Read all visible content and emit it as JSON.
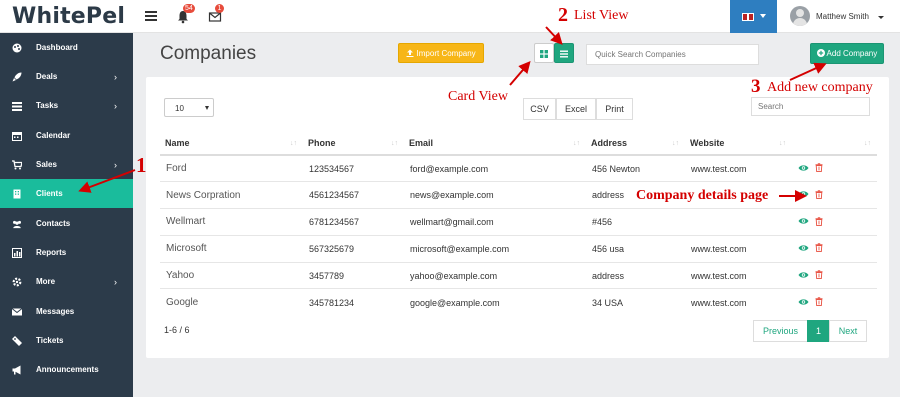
{
  "brand": {
    "logo": "WhitePel"
  },
  "topbar": {
    "notifications_count": "54",
    "messages_count": "1",
    "user_name": "Matthew Smith",
    "colors": {
      "lang_bg": "#2e7ec0",
      "badge": "#e74c3c"
    }
  },
  "sidebar": {
    "items": [
      {
        "label": "Dashboard",
        "icon": "palette-icon",
        "chevron": ""
      },
      {
        "label": "Deals",
        "icon": "rocket-icon",
        "chevron": "›"
      },
      {
        "label": "Tasks",
        "icon": "tasks-icon",
        "chevron": "›"
      },
      {
        "label": "Calendar",
        "icon": "calendar-icon",
        "chevron": ""
      },
      {
        "label": "Sales",
        "icon": "cart-icon",
        "chevron": "›"
      },
      {
        "label": "Clients",
        "icon": "building-icon",
        "chevron": ""
      },
      {
        "label": "Contacts",
        "icon": "users-icon",
        "chevron": ""
      },
      {
        "label": "Reports",
        "icon": "chart-icon",
        "chevron": ""
      },
      {
        "label": "More",
        "icon": "gear-icon",
        "chevron": "›"
      },
      {
        "label": "Messages",
        "icon": "envelope-icon",
        "chevron": ""
      },
      {
        "label": "Tickets",
        "icon": "ticket-icon",
        "chevron": ""
      },
      {
        "label": "Announcements",
        "icon": "bullhorn-icon",
        "chevron": ""
      }
    ],
    "active": "Clients",
    "colors": {
      "bg": "#2c3b4a",
      "active": "#1abc9c"
    }
  },
  "header": {
    "title": "Companies",
    "import_label": "Import Company",
    "search_placeholder": "Quick Search Companies",
    "add_label": "Add Company"
  },
  "table": {
    "page_size": "10",
    "export": {
      "csv": "CSV",
      "excel": "Excel",
      "print": "Print"
    },
    "search_placeholder": "Search",
    "columns": {
      "name": "Name",
      "phone": "Phone",
      "email": "Email",
      "address": "Address",
      "website": "Website"
    },
    "rows": [
      {
        "name": "Ford",
        "phone": "123534567",
        "email": "ford@example.com",
        "address": "456 Newton",
        "website": "www.test.com"
      },
      {
        "name": "News Corpration",
        "phone": "4561234567",
        "email": "news@example.com",
        "address": "address",
        "website": ""
      },
      {
        "name": "Wellmart",
        "phone": "6781234567",
        "email": "wellmart@gmail.com",
        "address": "#456",
        "website": ""
      },
      {
        "name": "Microsoft",
        "phone": "567325679",
        "email": "microsoft@example.com",
        "address": "456 usa",
        "website": "www.test.com"
      },
      {
        "name": "Yahoo",
        "phone": "3457789",
        "email": "yahoo@example.com",
        "address": "address",
        "website": "www.test.com"
      },
      {
        "name": "Google",
        "phone": "345781234",
        "email": "google@example.com",
        "address": "34 USA",
        "website": "www.test.com"
      }
    ],
    "count_text": "1-6 / 6",
    "pager": {
      "prev": "Previous",
      "current": "1",
      "next": "Next"
    },
    "colors": {
      "accent": "#1fa67f",
      "delete": "#e74c3c"
    }
  },
  "annotations": {
    "one": "1",
    "two": "2",
    "list_view": "List View",
    "card_view": "Card View",
    "three": "3",
    "add_new": "Add new company",
    "details": "Company details page",
    "color": "#d40000"
  }
}
